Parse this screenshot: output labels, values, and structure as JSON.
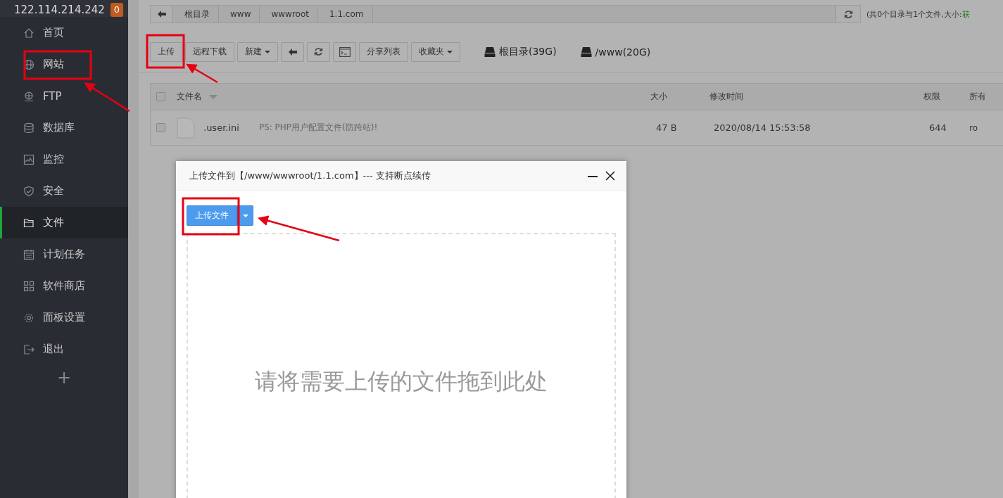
{
  "sidebar": {
    "host": "122.114.214.242",
    "badge": "0",
    "items": [
      {
        "label": "首页",
        "selected": false
      },
      {
        "label": "网站",
        "selected": false
      },
      {
        "label": "FTP",
        "selected": false
      },
      {
        "label": "数据库",
        "selected": false
      },
      {
        "label": "监控",
        "selected": false
      },
      {
        "label": "安全",
        "selected": false
      },
      {
        "label": "文件",
        "selected": true
      },
      {
        "label": "计划任务",
        "selected": false
      },
      {
        "label": "软件商店",
        "selected": false
      },
      {
        "label": "面板设置",
        "selected": false
      },
      {
        "label": "退出",
        "selected": false
      }
    ],
    "add": "+"
  },
  "breadcrumb": [
    "根目录",
    "www",
    "wwwroot",
    "1.1.com"
  ],
  "summary": {
    "text": "(共0个目录与1个文件,大小:",
    "link": "获"
  },
  "toolbar": [
    {
      "kind": "text",
      "label": "上传"
    },
    {
      "kind": "text",
      "label": "远程下载"
    },
    {
      "kind": "dropdown",
      "label": "新建"
    },
    {
      "kind": "back"
    },
    {
      "kind": "refresh"
    },
    {
      "kind": "terminal"
    },
    {
      "kind": "text",
      "label": "分享列表"
    },
    {
      "kind": "dropdown",
      "label": "收藏夹"
    }
  ],
  "disks": [
    "根目录(39G)",
    "/www(20G)"
  ],
  "table": {
    "all_checked": false,
    "columns": [
      "文件名",
      "大小",
      "修改时间",
      "权限",
      "所有"
    ],
    "rows": [
      {
        "name": ".user.ini",
        "note": "PS: PHP用户配置文件(防跨站)!",
        "size": "47 B",
        "modified": "2020/08/14 15:53:58",
        "perm": "644",
        "owner": "ro",
        "checked": false
      }
    ]
  },
  "dialog": {
    "title": "上传文件到【/www/wwwroot/1.1.com】--- 支持断点续传",
    "upload_button": "上传文件",
    "drop_hint": "请将需要上传的文件拖到此处"
  }
}
